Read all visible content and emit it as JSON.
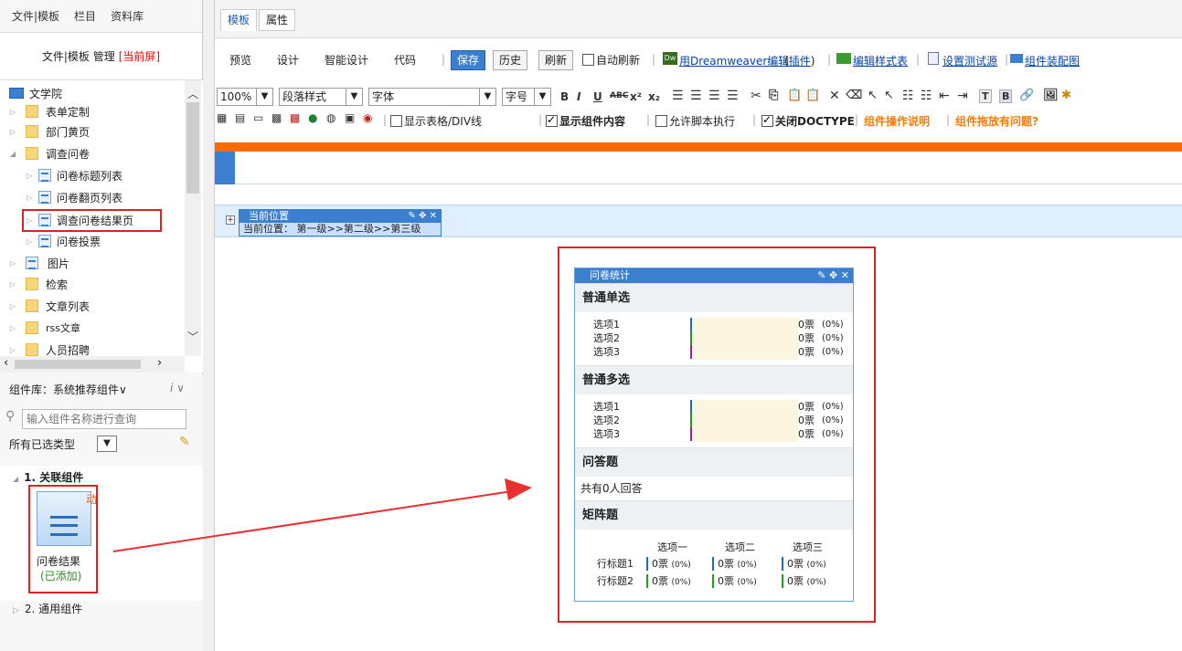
{
  "left": {
    "tabs": [
      "文件|模板",
      "栏目",
      "资料库"
    ],
    "subbar": {
      "prefix": "文件|模板 管理",
      "current": "[当前屏]"
    },
    "tree": {
      "items": [
        {
          "label": "文学院",
          "type": "root"
        },
        {
          "label": "表单定制",
          "type": "folder"
        },
        {
          "label": "部门黄页",
          "type": "folder"
        },
        {
          "label": "调查问卷",
          "type": "folder-open"
        },
        {
          "label": "问卷标题列表",
          "type": "page"
        },
        {
          "label": "问卷翻页列表",
          "type": "page"
        },
        {
          "label": "调查问卷结果页",
          "type": "page"
        },
        {
          "label": "问卷投票",
          "type": "page"
        },
        {
          "label": "图片",
          "type": "image"
        },
        {
          "label": "检索",
          "type": "folder"
        },
        {
          "label": "文章列表",
          "type": "folder"
        },
        {
          "label": "rss文章",
          "type": "folder"
        },
        {
          "label": "人员招聘",
          "type": "folder"
        }
      ]
    },
    "library": {
      "title": "组件库：系统推荐组件∨",
      "info": "i ∨",
      "search_placeholder": "输入组件名称进行查询",
      "type_select": "所有已选类型",
      "group1": "1. 关联组件",
      "card_name": "问卷结果",
      "card_status": "(已添加)",
      "card_badge": "动",
      "group2": "2. 通用组件"
    }
  },
  "right": {
    "tabs": [
      "模板",
      "属性"
    ],
    "menu": {
      "preview": "预览",
      "design": "设计",
      "smart": "智能设计",
      "code": "代码"
    },
    "buttons": {
      "save": "保存",
      "history": "历史",
      "refresh": "刷新"
    },
    "auto_refresh": "自动刷新",
    "links": {
      "dreamweaver": "用Dreamweaver编辑",
      "plugin": "插件",
      "style": "编辑样式表",
      "testsource": "设置测试源",
      "assembly": "组件装配图"
    },
    "toolbar": {
      "zoom": "100%",
      "paragraph": "段落样式",
      "font": "字体",
      "size": "字号",
      "show_table": "显示表格/DIV线",
      "show_comp": "显示组件内容",
      "allow_script": "允许脚本执行",
      "close_doctype": "关闭DOCTYPE",
      "comp_help": "组件操作说明",
      "drag_issue": "组件拖放有问题?"
    },
    "breadcrumb_comp": {
      "title": "当前位置",
      "text": "当前位置：  第一级>>第二级>>第三级"
    },
    "survey": {
      "title": "问卷统计",
      "single": "普通单选",
      "multi": "普通多选",
      "qa": "问答题",
      "qa_count": "共有0人回答",
      "matrix": "矩阵题",
      "options": [
        "选项1",
        "选项2",
        "选项3"
      ],
      "votes": "0票",
      "pct": "(0%)",
      "matrix_cols": [
        "选项一",
        "选项二",
        "选项三"
      ],
      "matrix_rows": [
        "行标题1",
        "行标题2"
      ],
      "colors": {
        "bar1": "#1a6fc0",
        "bar2": "#20a020",
        "bar3": "#a020a0",
        "header": "#3a7fd0",
        "highlight": "#e02020"
      }
    }
  }
}
